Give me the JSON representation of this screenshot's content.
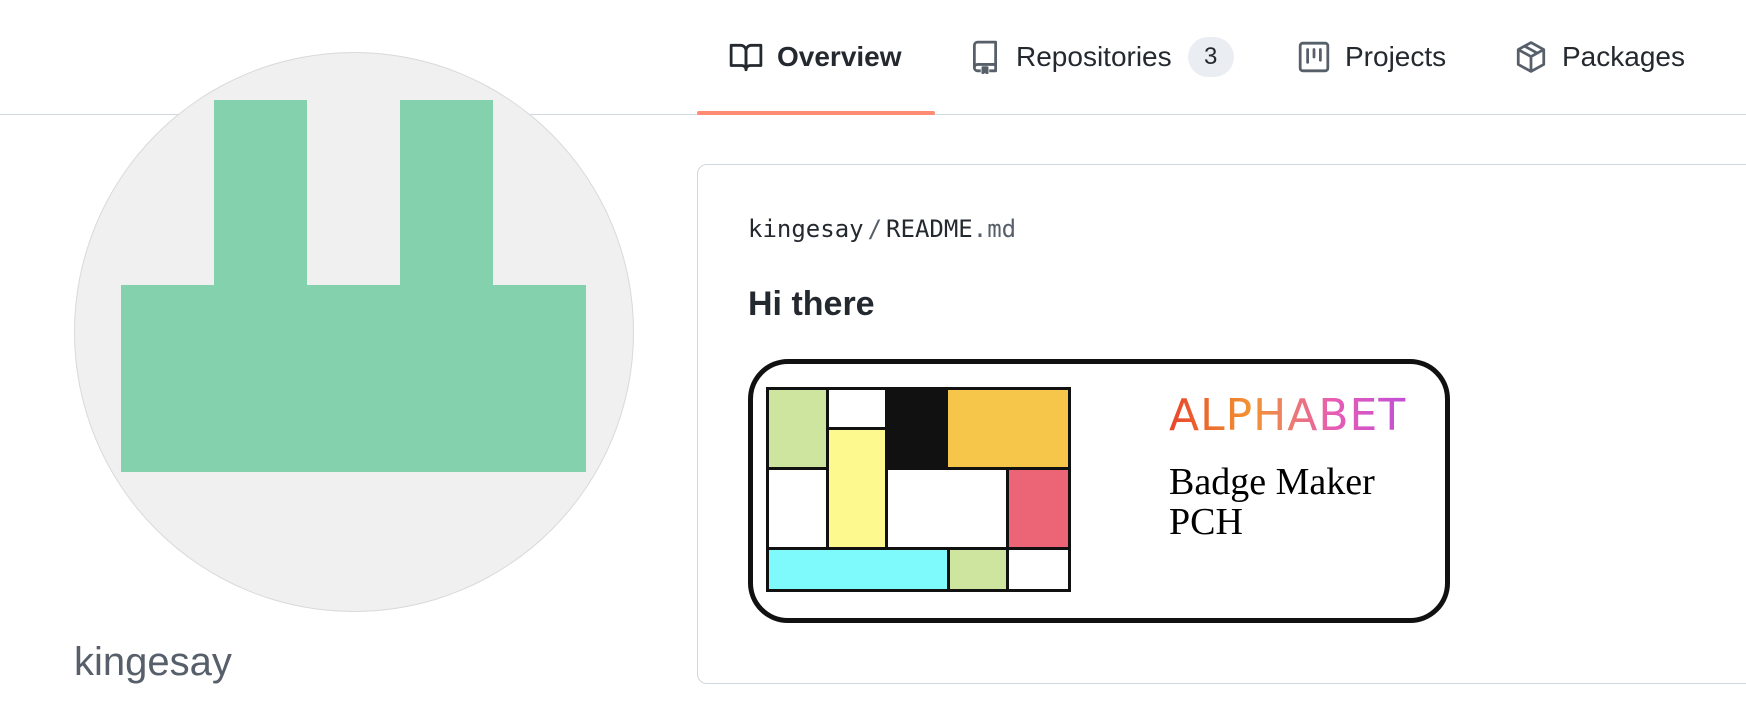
{
  "nav": {
    "tabs": [
      {
        "label": "Overview",
        "icon": "book-icon",
        "selected": true
      },
      {
        "label": "Repositories",
        "icon": "repo-icon",
        "count": "3"
      },
      {
        "label": "Projects",
        "icon": "project-icon"
      },
      {
        "label": "Packages",
        "icon": "package-icon"
      }
    ],
    "accent_color": "#fd8c73"
  },
  "profile": {
    "username": "kingesay",
    "avatar_color": "#83d1ad",
    "avatar_background": "#f0f0f0"
  },
  "readme": {
    "owner": "kingesay",
    "separator": "/",
    "file_base": "README",
    "file_ext": ".md",
    "heading": "Hi there",
    "badge": {
      "brand": "ALPHABET",
      "title_line1": "Badge Maker",
      "title_line2": "PCH",
      "palette": [
        "#cde59e",
        "#ffffff",
        "#111111",
        "#f5c649",
        "#fdf98e",
        "#ec6577",
        "#7ef9fc"
      ]
    }
  }
}
